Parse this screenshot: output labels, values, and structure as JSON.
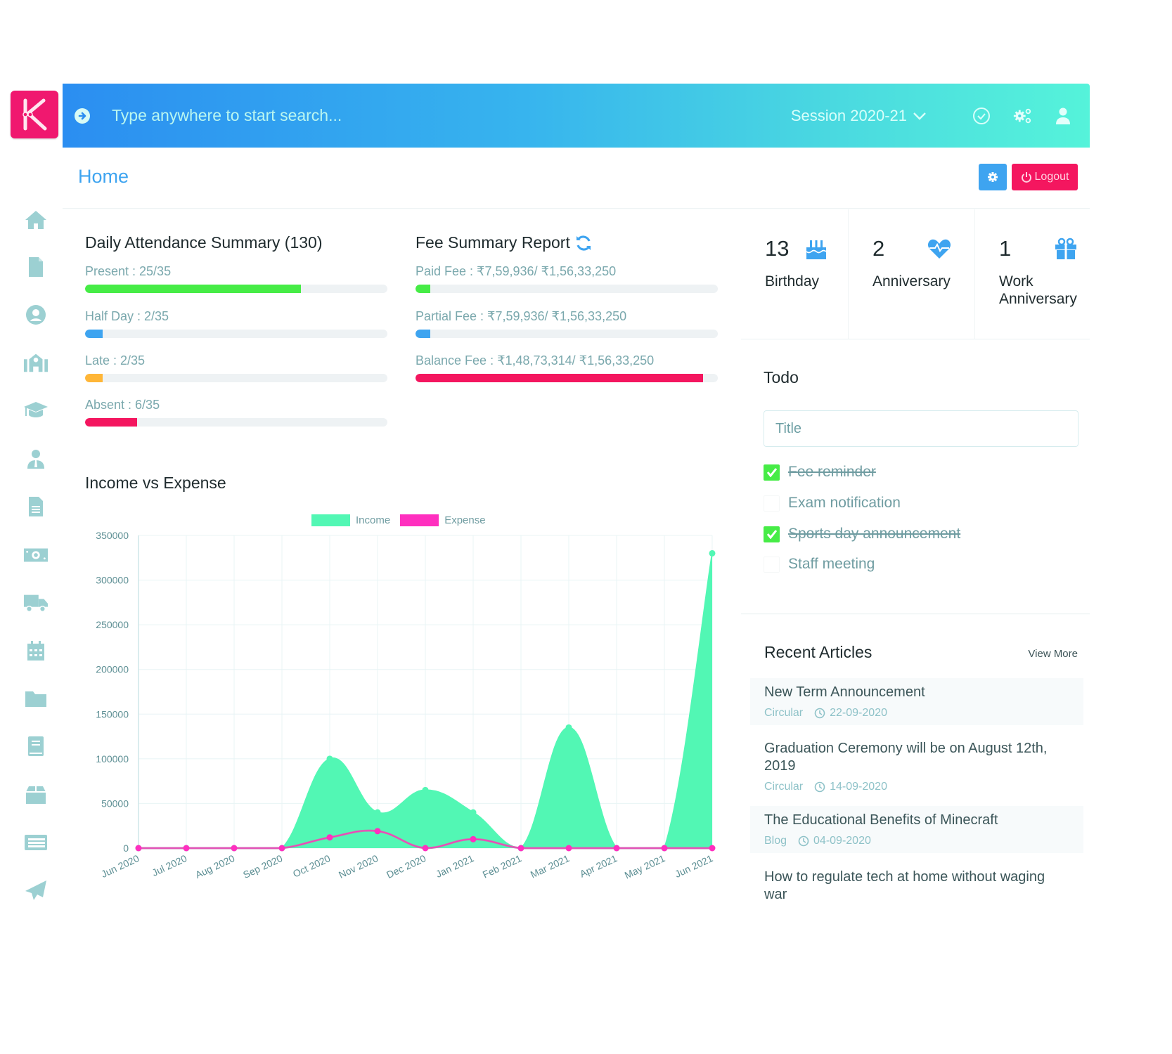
{
  "app": {
    "logo_letter": "K",
    "brand_color": "#f0186f"
  },
  "topbar": {
    "search_placeholder": "Type anywhere to start search...",
    "session_label": "Session 2020-21",
    "icons": [
      "arrow-circle-right-icon",
      "check-circle-icon",
      "cogs-icon",
      "user-icon"
    ]
  },
  "sidebar": {
    "items": [
      {
        "icon": "home-icon"
      },
      {
        "icon": "file-icon"
      },
      {
        "icon": "user-circle-icon"
      },
      {
        "icon": "school-icon"
      },
      {
        "icon": "graduation-cap-icon"
      },
      {
        "icon": "user-tie-icon"
      },
      {
        "icon": "file-alt-icon"
      },
      {
        "icon": "money-bill-icon"
      },
      {
        "icon": "truck-icon"
      },
      {
        "icon": "calendar-icon"
      },
      {
        "icon": "folder-icon"
      },
      {
        "icon": "book-icon"
      },
      {
        "icon": "box-icon"
      },
      {
        "icon": "list-table-icon"
      },
      {
        "icon": "paper-plane-icon"
      }
    ]
  },
  "header": {
    "title": "Home",
    "settings_button_icon": "cog-icon",
    "logout_label": "Logout"
  },
  "attendance": {
    "title": "Daily Attendance Summary (130)",
    "items": [
      {
        "label": "Present : 25/35",
        "value": 25,
        "total": 35,
        "color": "#46ec46"
      },
      {
        "label": "Half Day : 2/35",
        "value": 2,
        "total": 35,
        "color": "#3ea4f0"
      },
      {
        "label": "Late : 2/35",
        "value": 2,
        "total": 35,
        "color": "#ffb637"
      },
      {
        "label": "Absent : 6/35",
        "value": 6,
        "total": 35,
        "color": "#f4165f"
      }
    ]
  },
  "fees": {
    "title": "Fee Summary Report",
    "items": [
      {
        "label": "Paid Fee : ₹7,59,936/ ₹1,56,33,250",
        "value": 759936,
        "total": 15633250,
        "color": "#46ec46"
      },
      {
        "label": "Partial Fee : ₹7,59,936/ ₹1,56,33,250",
        "value": 759936,
        "total": 15633250,
        "color": "#3ea4f0"
      },
      {
        "label": "Balance Fee : ₹1,48,73,314/ ₹1,56,33,250",
        "value": 14873314,
        "total": 15633250,
        "color": "#f4165f"
      }
    ]
  },
  "stats": [
    {
      "count": "13",
      "label": "Birthday",
      "icon": "birthday-cake-icon"
    },
    {
      "count": "2",
      "label": "Anniversary",
      "icon": "heartbeat-icon"
    },
    {
      "count": "1",
      "label": "Work Anniversary",
      "icon": "gift-icon"
    }
  ],
  "todo": {
    "title": "Todo",
    "input_placeholder": "Title",
    "items": [
      {
        "text": "Fee reminder",
        "done": true
      },
      {
        "text": "Exam notification",
        "done": false
      },
      {
        "text": "Sports day announcement",
        "done": true
      },
      {
        "text": "Staff meeting",
        "done": false
      }
    ]
  },
  "articles": {
    "title": "Recent Articles",
    "view_more": "View More",
    "items": [
      {
        "title": "New Term Announcement",
        "category": "Circular",
        "date": "22-09-2020"
      },
      {
        "title": "Graduation Ceremony will be on August 12th, 2019",
        "category": "Circular",
        "date": "14-09-2020"
      },
      {
        "title": "The Educational Benefits of Minecraft",
        "category": "Blog",
        "date": "04-09-2020"
      },
      {
        "title": "How to regulate tech at home without waging war",
        "category": "",
        "date": ""
      }
    ]
  },
  "chart_data": {
    "type": "area",
    "title": "Income vs Expense",
    "xlabel": "",
    "ylabel": "",
    "categories": [
      "Jun 2020",
      "Jul 2020",
      "Aug 2020",
      "Sep 2020",
      "Oct 2020",
      "Nov 2020",
      "Dec 2020",
      "Jan 2021",
      "Feb 2021",
      "Mar 2021",
      "Apr 2021",
      "May 2021",
      "Jun 2021"
    ],
    "series": [
      {
        "name": "Income",
        "color": "#52f7b4",
        "values": [
          0,
          0,
          0,
          0,
          100000,
          40000,
          65000,
          40000,
          0,
          135000,
          0,
          0,
          330000
        ]
      },
      {
        "name": "Expense",
        "color": "#ff2fbf",
        "values": [
          0,
          0,
          0,
          0,
          12000,
          19000,
          0,
          10000,
          0,
          0,
          0,
          0,
          0
        ]
      }
    ],
    "ylim": [
      0,
      350000
    ],
    "yticks": [
      0,
      50000,
      100000,
      150000,
      200000,
      250000,
      300000,
      350000
    ],
    "grid": true,
    "legend": "top-center"
  }
}
